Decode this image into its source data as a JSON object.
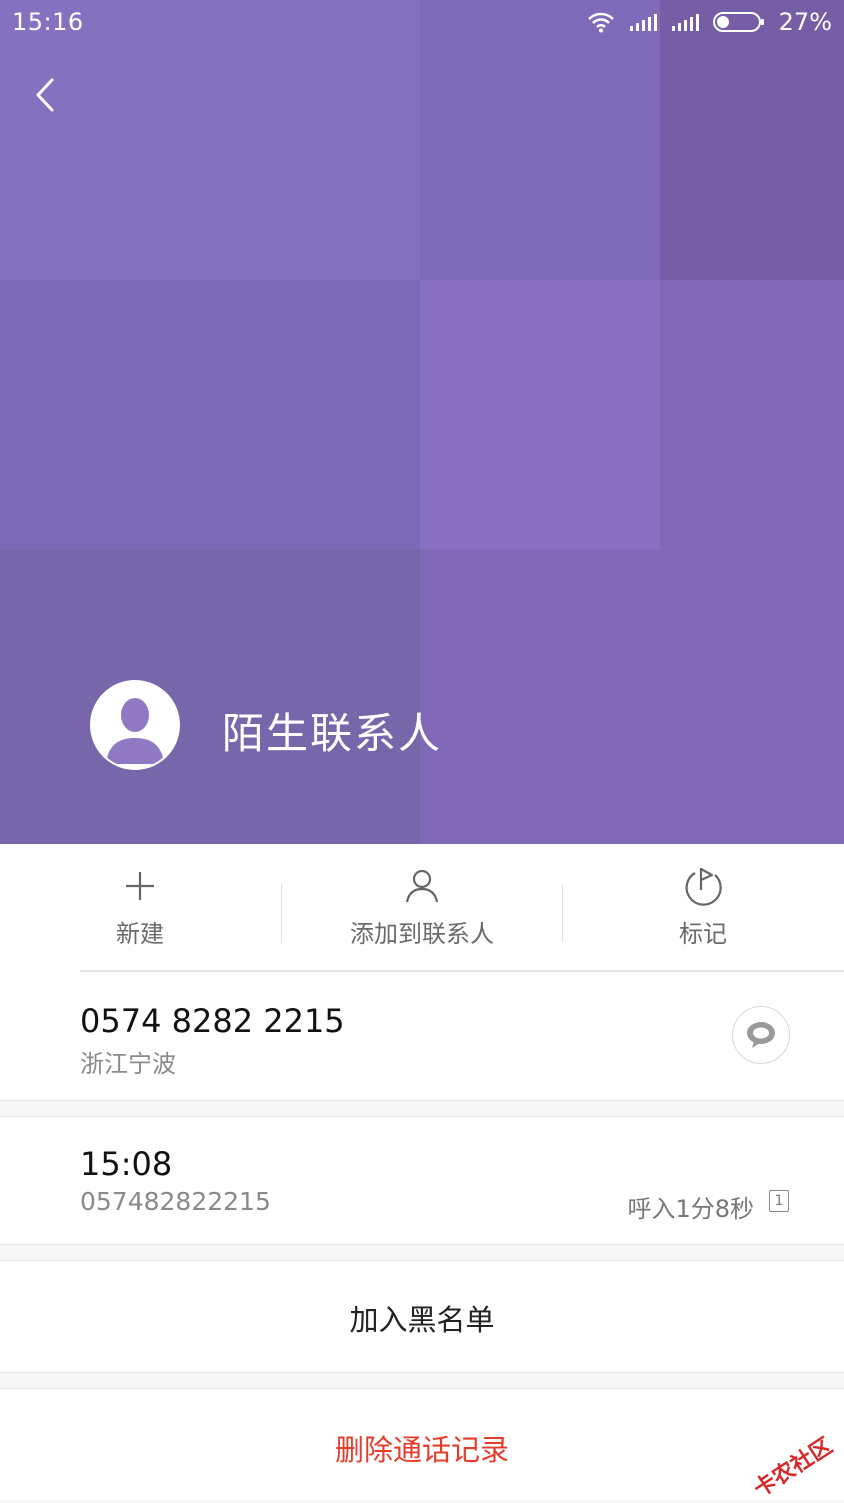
{
  "status_bar": {
    "time": "15:16",
    "battery_percent": "27%",
    "battery_level": 0.27,
    "icons": [
      "wifi-icon",
      "signal-icon",
      "signal-icon",
      "battery-icon"
    ]
  },
  "header": {
    "back_icon": "chevron-left-icon",
    "contact_name": "陌生联系人",
    "avatar_icon": "person-silhouette-icon",
    "background_color": "#8269b8"
  },
  "actions": [
    {
      "label": "新建",
      "icon": "plus-icon"
    },
    {
      "label": "添加到联系人",
      "icon": "person-outline-icon"
    },
    {
      "label": "标记",
      "icon": "flag-icon"
    }
  ],
  "number_card": {
    "phone_number": "0574 8282 2215",
    "location": "浙江宁波",
    "message_icon": "message-bubble-icon"
  },
  "call_record": {
    "time": "15:08",
    "number": "057482822215",
    "detail": "呼入1分8秒",
    "sim_slot": "1"
  },
  "blacklist_button": "加入黑名单",
  "delete_button": "删除通话记录",
  "watermark": "卡农社区",
  "colors": {
    "accent_danger": "#e53d2b",
    "text_primary": "#111111",
    "text_secondary": "#8a8a8a"
  }
}
